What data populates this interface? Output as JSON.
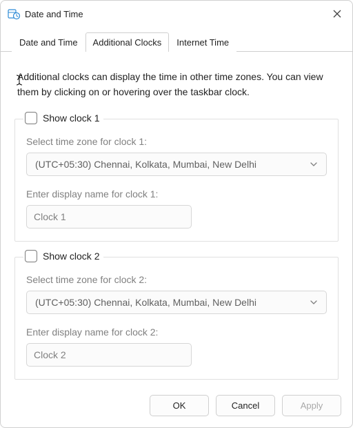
{
  "window": {
    "title": "Date and Time"
  },
  "tabs": [
    {
      "label": "Date and Time"
    },
    {
      "label": "Additional Clocks"
    },
    {
      "label": "Internet Time"
    }
  ],
  "description": "Additional clocks can display the time in other time zones. You can view them by clicking on or hovering over the taskbar clock.",
  "clock1": {
    "legend": "Show clock 1",
    "tz_label": "Select time zone for clock 1:",
    "tz_value": "(UTC+05:30) Chennai, Kolkata, Mumbai, New Delhi",
    "name_label": "Enter display name for clock 1:",
    "name_value": "Clock 1"
  },
  "clock2": {
    "legend": "Show clock 2",
    "tz_label": "Select time zone for clock 2:",
    "tz_value": "(UTC+05:30) Chennai, Kolkata, Mumbai, New Delhi",
    "name_label": "Enter display name for clock 2:",
    "name_value": "Clock 2"
  },
  "buttons": {
    "ok": "OK",
    "cancel": "Cancel",
    "apply": "Apply"
  }
}
